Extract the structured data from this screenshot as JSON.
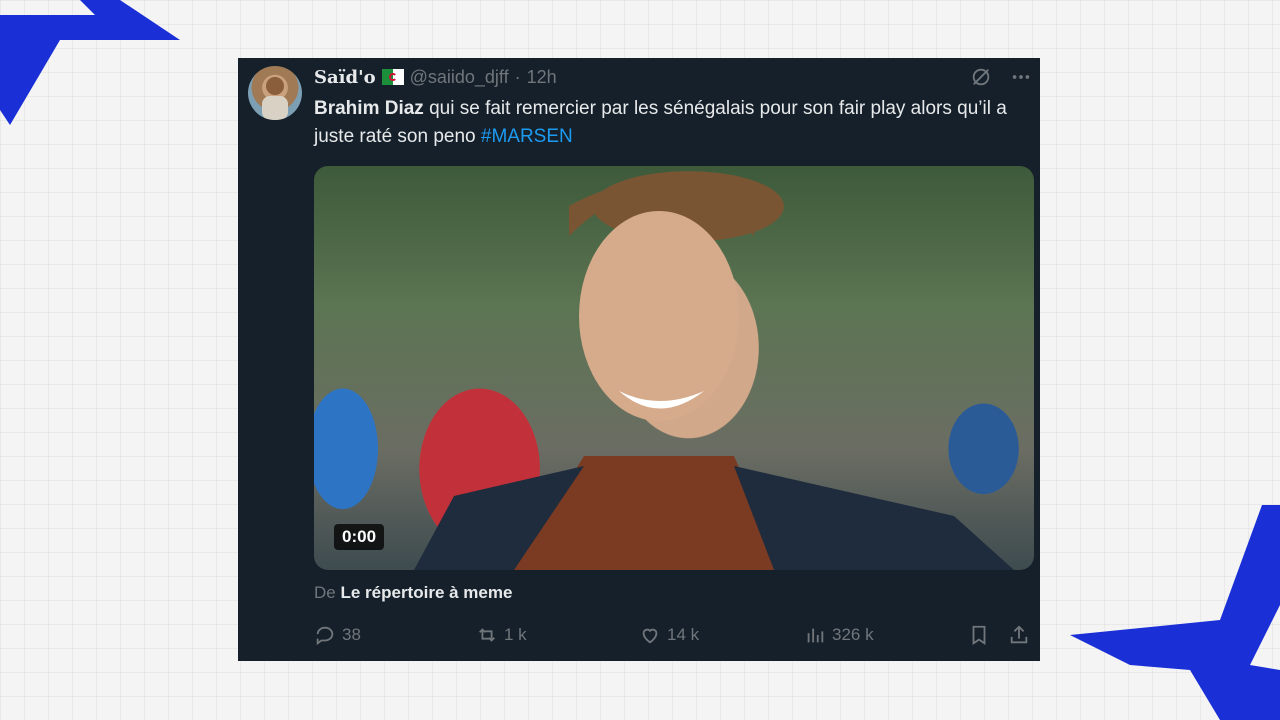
{
  "tweet": {
    "display_name": "Saïd'o",
    "flag_icon": "algeria-flag-icon",
    "handle": "@saiido_djff",
    "separator": "·",
    "time": "12h",
    "text_bold": "Brahim Diaz",
    "text_rest": " qui se fait remercier par les sénégalais pour son fair play alors qu’il a juste raté son peno ",
    "hashtag": "#MARSEN",
    "video_time": "0:00",
    "attribution_prefix": "De ",
    "attribution_source": "Le répertoire à meme",
    "replies": "38",
    "retweets": "1 k",
    "likes": "14 k",
    "views": "326 k"
  },
  "colors": {
    "card_bg": "#15202b",
    "text": "#e7e9ea",
    "muted": "#71767b",
    "link": "#1d9bf0",
    "deco_blue": "#1a2fd6"
  }
}
